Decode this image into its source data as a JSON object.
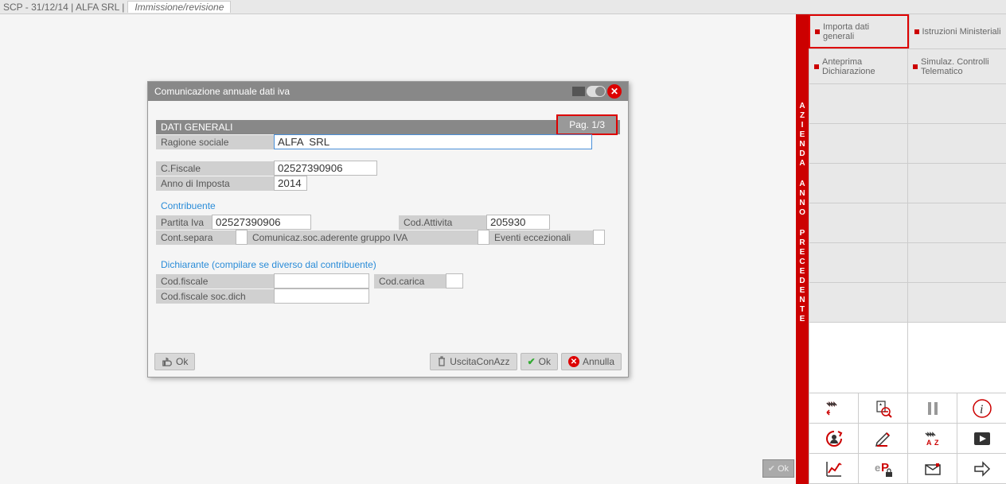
{
  "header": {
    "breadcrumb": "SCP - 31/12/14 | ALFA SRL  |",
    "tab": "Immissione/revisione"
  },
  "dialog": {
    "title": "Comunicazione annuale dati iva",
    "section_header": "DATI GENERALI",
    "page_indicator": "Pag. 1/3",
    "labels": {
      "ragione_sociale": "Ragione sociale",
      "c_fiscale": "C.Fiscale",
      "anno_imposta": "Anno di Imposta",
      "contribuente": "Contribuente",
      "partita_iva": "Partita Iva",
      "cod_attivita": "Cod.Attivita",
      "cont_separa": "Cont.separa",
      "comunicaz": "Comunicaz.soc.aderente gruppo IVA",
      "eventi": "Eventi eccezionali",
      "dichiarante": "Dichiarante (compilare se diverso dal contribuente)",
      "cod_fiscale": "Cod.fiscale",
      "cod_carica": "Cod.carica",
      "cod_fiscale_soc": "Cod.fiscale soc.dich"
    },
    "values": {
      "ragione_sociale": "ALFA  SRL",
      "c_fiscale": "02527390906",
      "anno_imposta": "2014",
      "partita_iva": "02527390906",
      "cod_attivita": "205930",
      "cont_separa": "",
      "eventi": "",
      "cod_fiscale": "",
      "cod_carica": "",
      "cod_fiscale_soc": ""
    },
    "buttons": {
      "ok_left": "Ok",
      "uscita": "UscitaConAzz",
      "ok_right": "Ok",
      "annulla": "Annulla"
    }
  },
  "bottom_ok": "Ok",
  "right_panel": {
    "strip1": "AZIENDA",
    "strip2": "ANNO",
    "strip3": "PRECEDENTE",
    "cells": {
      "r0c0": "Importa dati generali",
      "r0c1": "Istruzioni Ministeriali",
      "r1c0": "Anteprima Dichiarazione",
      "r1c1": "Simulaz. Controlli Telematico"
    },
    "icons": {
      "factory_back": "factory-back-icon",
      "zoom": "zoom-icon",
      "pause": "pause-icon",
      "info": "info-icon",
      "refresh_user": "refresh-user-icon",
      "edit": "edit-icon",
      "factory_az": "factory-az-icon",
      "play": "play-icon",
      "chart": "chart-icon",
      "ep_lock": "ep-lock-icon",
      "message": "message-icon",
      "arrow": "arrow-right-icon"
    }
  }
}
